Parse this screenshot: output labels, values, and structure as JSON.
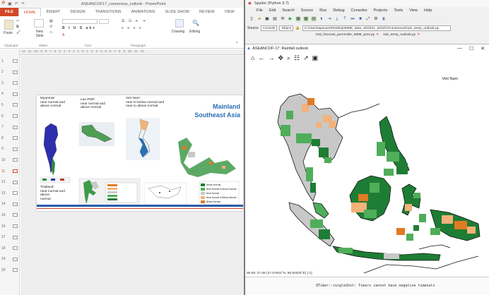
{
  "powerpoint": {
    "window_title": "ASEANCOF17_consensus_outlook - PowerPoint",
    "tabs": [
      "FILE",
      "HOME",
      "INSERT",
      "DESIGN",
      "TRANSITIONS",
      "ANIMATIONS",
      "SLIDE SHOW",
      "REVIEW",
      "VIEW"
    ],
    "active_tab": "HOME",
    "ribbon": {
      "paste": "Paste",
      "new_slide": "New Slide",
      "drawing": "Drawing",
      "editing": "Editing",
      "groups": [
        "Clipboard",
        "Slides",
        "Font",
        "Paragraph"
      ]
    },
    "ruler": "· 12 · 11 · 10 · 9 · 8 · 7 · 6 · 5 · 4 · 3 · 2 · 1 · 0 · 1 · 2 · 3 · 4 · 5 · 6 · 7 · 8 · 9 · 10 · 11 · 12 ·",
    "slide_numbers": [
      "1",
      "2",
      "3",
      "4",
      "5",
      "6",
      "7",
      "8",
      "9",
      "10",
      "11",
      "12",
      "13",
      "14",
      "15",
      "16",
      "17",
      "18",
      "19",
      "20"
    ],
    "active_slide": "11",
    "slide": {
      "title_line1": "Mainland",
      "title_line2": "Southeast Asia",
      "myanmar_1": "Myanmar:",
      "myanmar_2": "near normal and",
      "myanmar_3": "above normal",
      "laos_1": "Lao PDR:",
      "laos_2": "near normal and",
      "laos_3": "above normal",
      "vietnam_1": "Viet Nam:",
      "vietnam_2": "near to below normal and",
      "vietnam_3": "near to above normal",
      "thailand_1": "Thailand:",
      "thailand_2": "near normal and",
      "thailand_3": "above",
      "thailand_4": "normal",
      "legend": [
        "Above Normal",
        "Near Normal to Above Normal",
        "Near Normal",
        "Near Normal to Below Normal",
        "Below Normal"
      ]
    }
  },
  "spyder": {
    "window_title": "Spyder (Python 3.7)",
    "menu": [
      "File",
      "Edit",
      "Search",
      "Source",
      "Run",
      "Debug",
      "Consoles",
      "Projects",
      "Tools",
      "View",
      "Help"
    ],
    "source_label": "Source",
    "console_select": "Console",
    "object_select": "Object",
    "path": "C:\\Users\\apsuser\\Desktop\\MME_data_v5\\2021_2022\\rr\\Consensus\\rain_temp_outlook.py",
    "file_tabs": [
      "trial_forecast_percentile_MME_pres.py",
      "rain_temp_outlook.py"
    ],
    "figure": {
      "title": "ASEANCOF-17: Rainfall outlook",
      "map_label": "Viet Nam",
      "status": "96.89, 27.08 (27.07942°N, 96.84525°E) [-1]",
      "console": "QTimer::singleShot: Timers cannot have negative timeouts"
    }
  },
  "colors": {
    "ppt_accent": "#d24726",
    "above_normal": "#1e7d34",
    "near_above": "#4fae5a",
    "near_normal": "#c8c8c8",
    "near_below": "#f2b27a",
    "below_normal": "#e07b24"
  }
}
